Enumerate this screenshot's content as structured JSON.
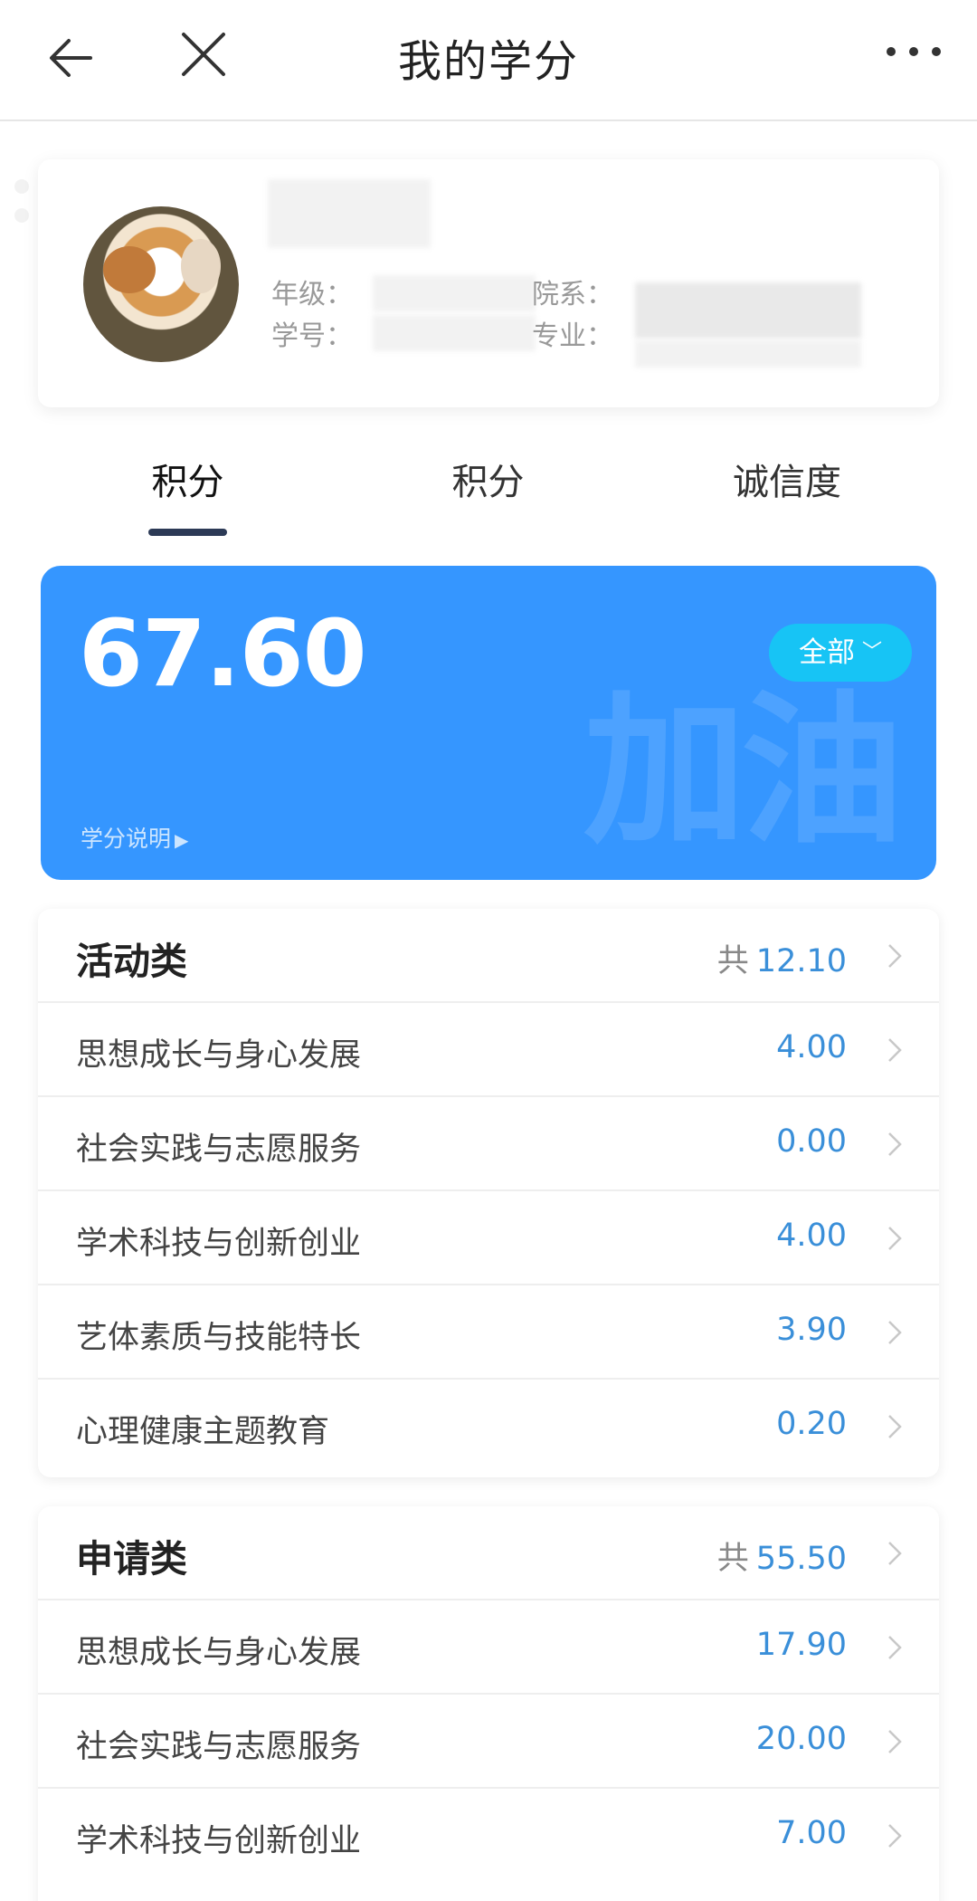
{
  "header": {
    "title": "我的学分"
  },
  "profile": {
    "grade_label": "年级：",
    "id_label": "学号：",
    "dept_label": "院系：",
    "major_label": "专业："
  },
  "tabs": [
    {
      "label": "积分",
      "active": true
    },
    {
      "label": "积分",
      "active": false
    },
    {
      "label": "诚信度",
      "active": false
    }
  ],
  "score": {
    "value": "67.60",
    "watermark": "加油",
    "filter_label": "全部",
    "explain_label": "学分说明"
  },
  "sections": [
    {
      "title": "活动类",
      "total_prefix": "共",
      "total": "12.10",
      "items": [
        {
          "label": "思想成长与身心发展",
          "value": "4.00"
        },
        {
          "label": "社会实践与志愿服务",
          "value": "0.00"
        },
        {
          "label": "学术科技与创新创业",
          "value": "4.00"
        },
        {
          "label": "艺体素质与技能特长",
          "value": "3.90"
        },
        {
          "label": "心理健康主题教育",
          "value": "0.20"
        }
      ]
    },
    {
      "title": "申请类",
      "total_prefix": "共",
      "total": "55.50",
      "items": [
        {
          "label": "思想成长与身心发展",
          "value": "17.90"
        },
        {
          "label": "社会实践与志愿服务",
          "value": "20.00"
        },
        {
          "label": "学术科技与创新创业",
          "value": "7.00"
        }
      ]
    }
  ],
  "colors": {
    "accent": "#3596ff",
    "value_blue": "#3a8fd9",
    "filter_pill": "#17c4f5"
  }
}
